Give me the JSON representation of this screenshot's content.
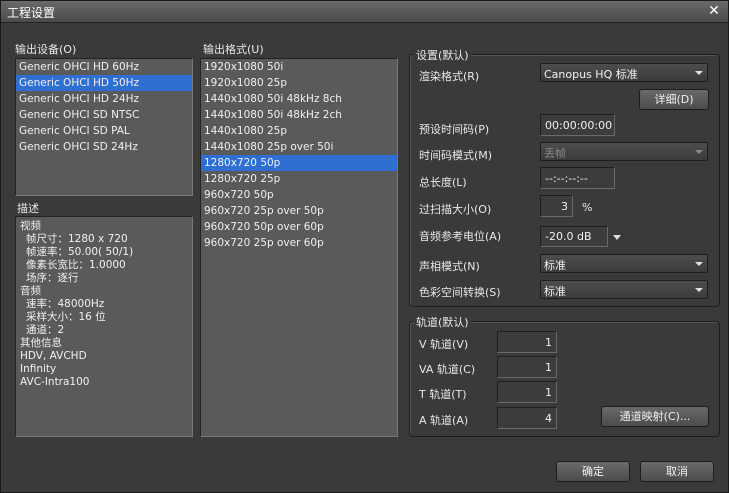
{
  "window": {
    "title": "工程设置",
    "close_glyph": "✕"
  },
  "output_device": {
    "label": "输出设备(O)",
    "items": [
      "Generic OHCI HD 60Hz",
      "Generic OHCI HD 50Hz",
      "Generic OHCI HD 24Hz",
      "Generic OHCI SD NTSC",
      "Generic OHCI SD PAL",
      "Generic OHCI SD 24Hz"
    ],
    "selected_index": 1
  },
  "description": {
    "label": "描述",
    "lines": [
      "视频",
      "帧尺寸：1280 x 720",
      "帧速率：50.00( 50/1)",
      "像素长宽比：1.0000",
      "场序：逐行",
      "音频",
      "速率：48000Hz",
      "采样大小：16 位",
      "通道：2",
      "其他信息",
      "HDV, AVCHD",
      "Infinity",
      "AVC-Intra100"
    ]
  },
  "output_format": {
    "label": "输出格式(U)",
    "items": [
      "1920x1080 50i",
      "1920x1080 25p",
      "1440x1080 50i 48kHz 8ch",
      "1440x1080 50i 48kHz 2ch",
      "1440x1080 25p",
      "1440x1080 25p over 50i",
      "1280x720 50p",
      "1280x720 25p",
      "960x720 50p",
      "960x720 25p over 50p",
      "960x720 50p over 60p",
      "960x720 25p over 60p"
    ],
    "selected_index": 6
  },
  "settings": {
    "group_label": "设置(默认)",
    "render_format_label": "渲染格式(R)",
    "render_format_value": "Canopus HQ 标准",
    "details_button": "详细(D)",
    "preset_timecode_label": "预设时间码(P)",
    "preset_timecode_value": "00:00:00:00",
    "timecode_mode_label": "时间码模式(M)",
    "timecode_mode_value": "丢帧",
    "total_length_label": "总长度(L)",
    "total_length_value": "--:--:--:--",
    "overscan_label": "过扫描大小(O)",
    "overscan_value": "3",
    "overscan_unit": "%",
    "audio_ref_label": "音频参考电位(A)",
    "audio_ref_value": "-20.0 dB",
    "phase_mode_label": "声相模式(N)",
    "phase_mode_value": "标准",
    "color_space_label": "色彩空间转换(S)",
    "color_space_value": "标准"
  },
  "tracks": {
    "group_label": "轨道(默认)",
    "v_label": "V 轨道(V)",
    "v_value": "1",
    "va_label": "VA 轨道(C)",
    "va_value": "1",
    "t_label": "T 轨道(T)",
    "t_value": "1",
    "a_label": "A 轨道(A)",
    "a_value": "4",
    "channel_map_button": "通道映射(C)..."
  },
  "footer": {
    "ok": "确定",
    "cancel": "取消"
  }
}
